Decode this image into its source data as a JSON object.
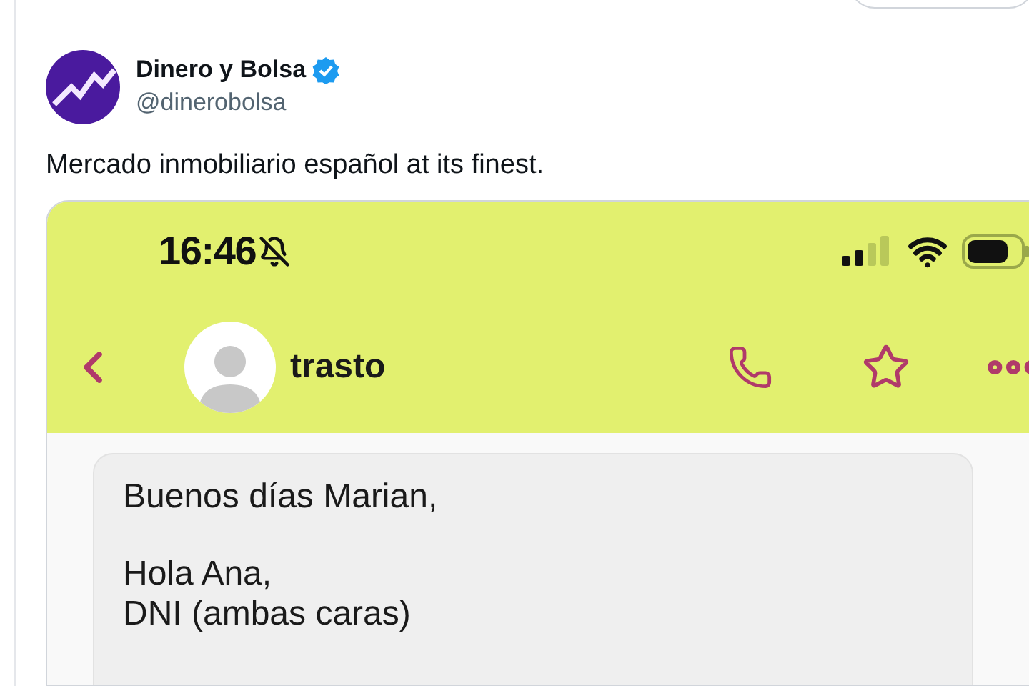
{
  "tweet": {
    "author": {
      "name": "Dinero y Bolsa",
      "verified": true,
      "handle": "@dinerobolsa"
    },
    "text": "Mercado inmobiliario español at its finest.",
    "image": {
      "status_bar": {
        "time": "16:46",
        "muted": true
      },
      "chat_header": {
        "contact": "trasto"
      },
      "message": {
        "paragraphs": [
          [
            "Buenos días Marian,"
          ],
          [
            "Hola Ana,",
            "DNI (ambas caras)"
          ]
        ]
      }
    }
  }
}
